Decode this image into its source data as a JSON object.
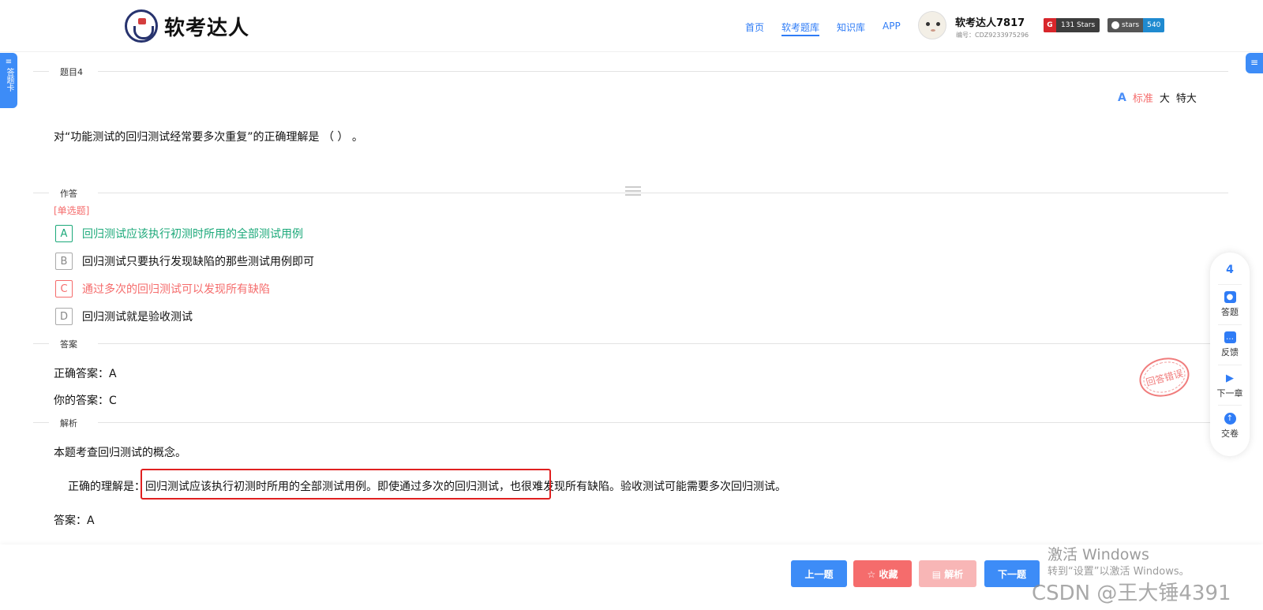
{
  "header": {
    "logo_text": "软考达人",
    "nav": [
      "首页",
      "软考题库",
      "知识库",
      "APP"
    ],
    "active_nav": "软考题库",
    "user_name": "软考达人7817",
    "user_id": "编号：CDZ9233975296",
    "badge_g_icon": "G",
    "badge_g_text": "131 Stars",
    "badge_gh_text": "stars",
    "badge_gh_count": "540"
  },
  "side": {
    "left_tab_icon": "≡",
    "left_tab_label": "答题卡",
    "right_tab_icon": "≡"
  },
  "question": {
    "section_label": "题目4",
    "font_icon": "A",
    "font_sizes": [
      "标准",
      "大",
      "特大"
    ],
    "text": "对“功能测试的回归测试经常要多次重复”的正确理解是 （ ） 。"
  },
  "answer_area": {
    "section_label": "作答",
    "type": "[单选题]",
    "options": [
      {
        "key": "A",
        "text": "回归测试应该执行初测时所用的全部测试用例",
        "state": "correct"
      },
      {
        "key": "B",
        "text": "回归测试只要执行发现缺陷的那些测试用例即可",
        "state": "normal"
      },
      {
        "key": "C",
        "text": "通过多次的回归测试可以发现所有缺陷",
        "state": "wrong"
      },
      {
        "key": "D",
        "text": "回归测试就是验收测试",
        "state": "normal"
      }
    ]
  },
  "result": {
    "section_label": "答案",
    "correct_answer": "正确答案：A",
    "your_answer": "你的答案：C",
    "stamp": "回答错误"
  },
  "analysis": {
    "section_label": "解析",
    "line1": "本题考查回归测试的概念。",
    "line2_prefix": "正确的理解是：",
    "line2_highlight": "回归测试应该执行初测时所用的全部测试用例。即使通过多次的回归测试，",
    "line2_suffix": "也很难发现所有缺陷。验收测试可能需要多次回归测试。",
    "line3": "答案：A"
  },
  "panel": {
    "number": "4",
    "items": [
      "答题",
      "反馈",
      "下一章",
      "交卷"
    ]
  },
  "buttons": {
    "prev": "上一题",
    "fav": "☆ 收藏",
    "analysis": "▤ 解析",
    "next": "下一题"
  },
  "watermark": {
    "line1": "激活 Windows",
    "line2": "转到“设置”以激活 Windows。",
    "csdn": "CSDN @王大锤4391"
  },
  "colors": {
    "primary": "#3d8cf7",
    "correct": "#1ca97a",
    "wrong": "#f56c6c",
    "highlight_box": "#e02020"
  }
}
